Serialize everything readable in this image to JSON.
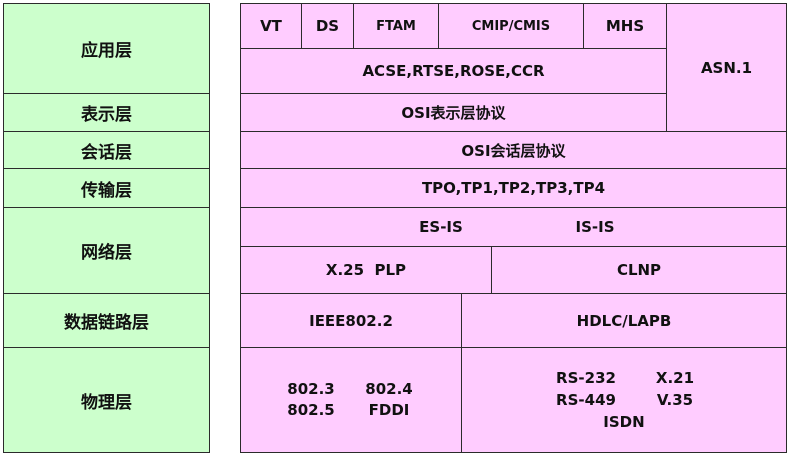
{
  "layers": {
    "application": "应用层",
    "presentation": "表示层",
    "session": "会话层",
    "transport": "传输层",
    "network": "网络层",
    "datalink": "数据链路层",
    "physical": "物理层"
  },
  "protocols": {
    "vt": "VT",
    "ds": "DS",
    "ftam": "FTAM",
    "cmip": "CMIP/CMIS",
    "mhs": "MHS",
    "asn1": "ASN.1",
    "acse": "ACSE,RTSE,ROSE,CCR",
    "osi_presentation": "OSI表示层协议",
    "osi_session": "OSI会话层协议",
    "tp": "TPO,TP1,TP2,TP3,TP4",
    "esis": "ES-IS",
    "isis": "IS-IS",
    "x25plp": "X.25  PLP",
    "clnp": "CLNP",
    "ieee8022": "IEEE802.2",
    "hdlc": "HDLC/LAPB",
    "phys_left": [
      "802.3",
      "802.4",
      "802.5",
      "FDDI"
    ],
    "phys_right": [
      "RS-232",
      "X.21",
      "RS-449",
      "V.35",
      "ISDN"
    ]
  }
}
